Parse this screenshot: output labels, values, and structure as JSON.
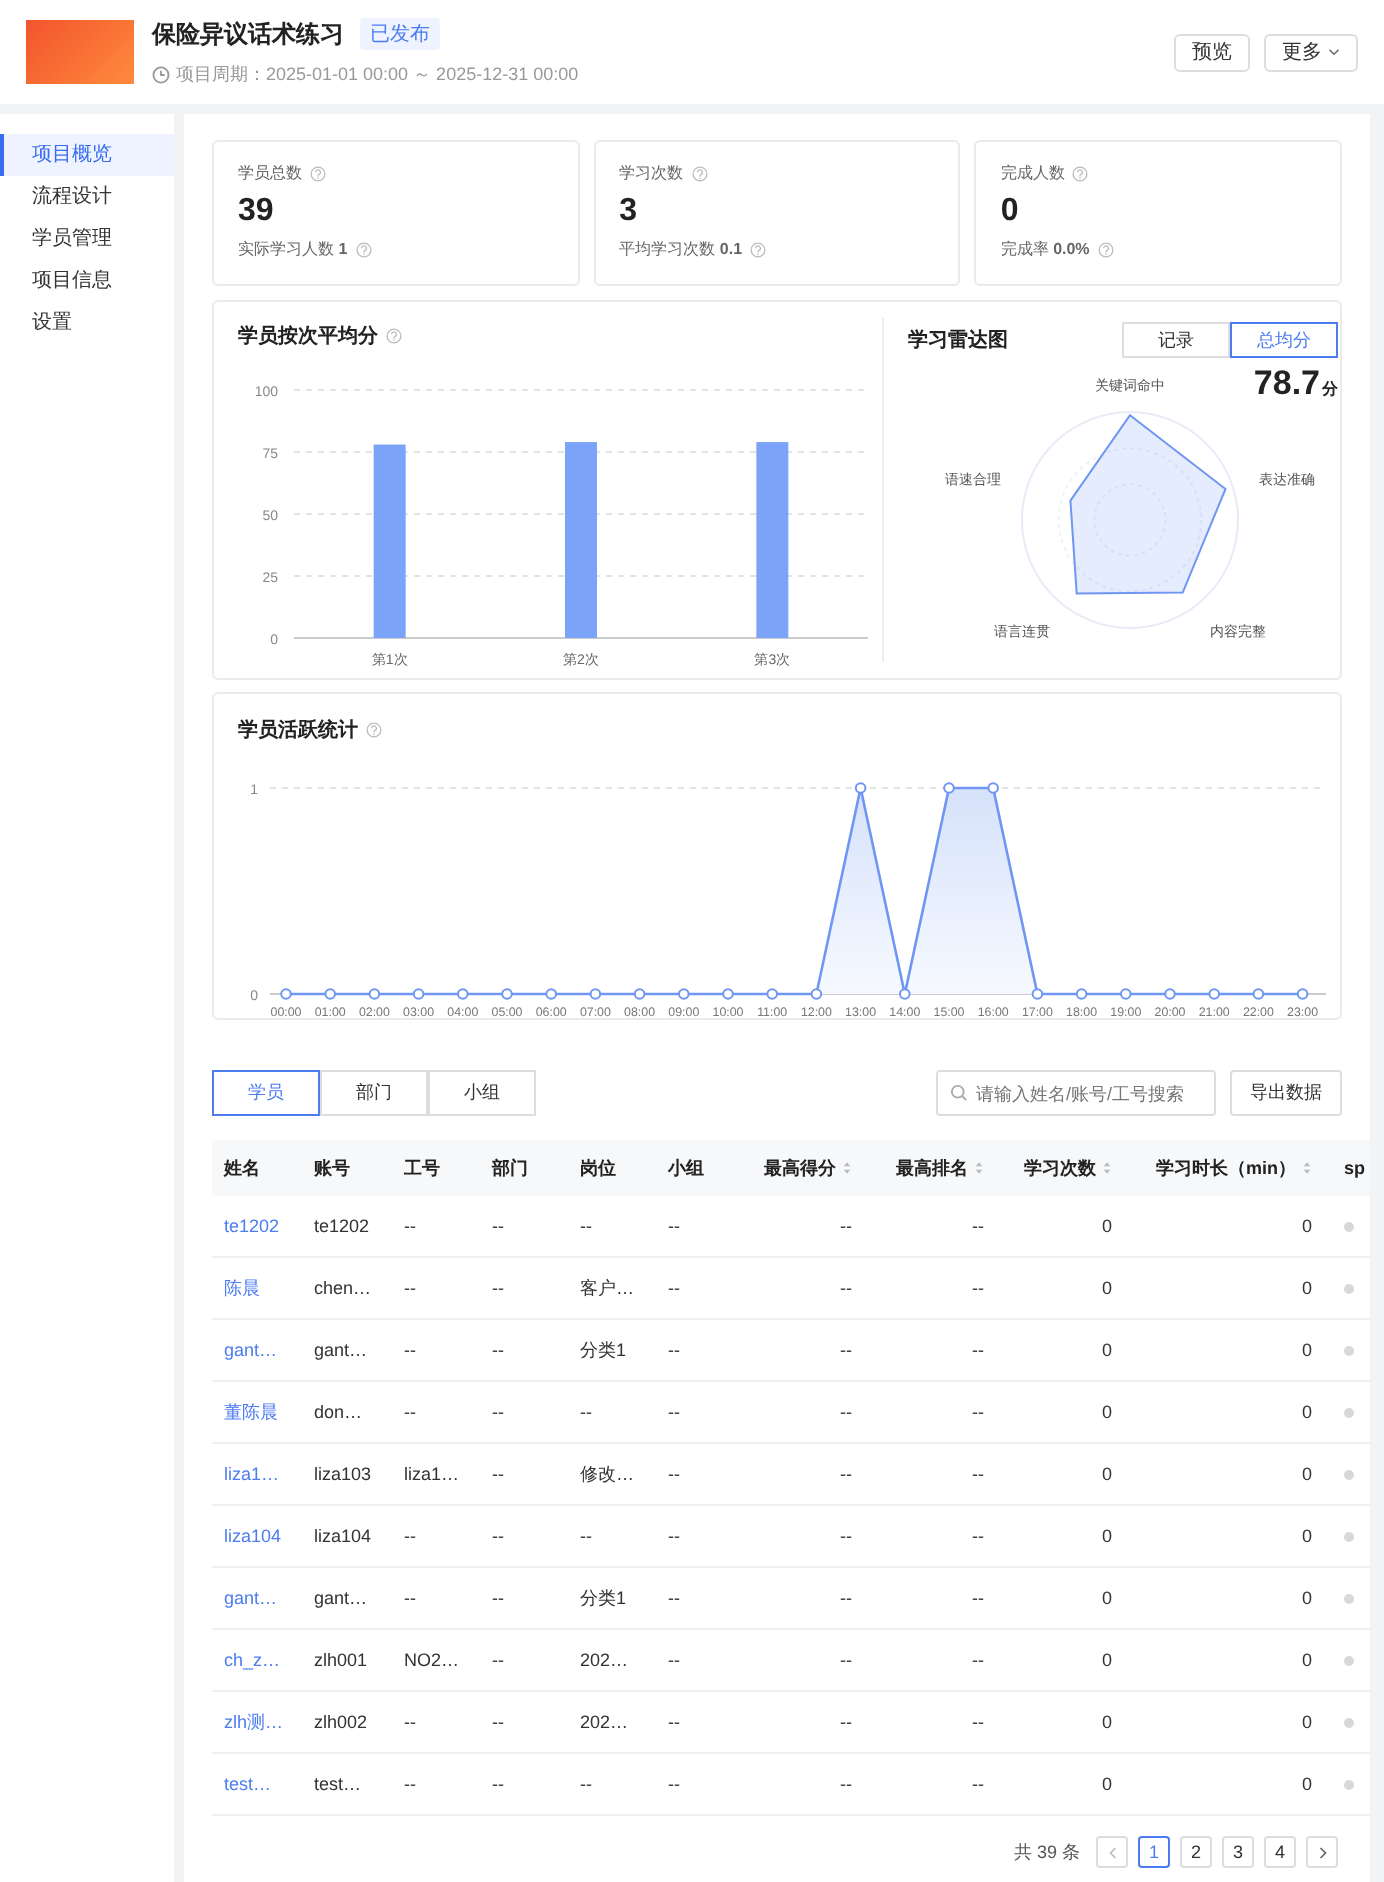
{
  "header": {
    "title": "保险异议话术练习",
    "status": "已发布",
    "period": "项目周期：2025-01-01 00:00 ～ 2025-12-31 00:00",
    "buttons": [
      {
        "label": "预览",
        "kind": "plain"
      },
      {
        "label": "更多",
        "kind": "dropdown"
      }
    ]
  },
  "sidebar": {
    "items": [
      {
        "label": "项目概览",
        "selected": true
      },
      {
        "label": "流程设计",
        "selected": false
      },
      {
        "label": "学员管理",
        "selected": false
      },
      {
        "label": "项目信息",
        "selected": false
      },
      {
        "label": "设置",
        "selected": false
      }
    ]
  },
  "stats": [
    {
      "label": "学员总数",
      "value": "39",
      "sub": "实际学习人数 **1**"
    },
    {
      "label": "学习次数",
      "value": "3",
      "sub": "平均学习次数 **0.1**"
    },
    {
      "label": "完成人数",
      "value": "0",
      "sub": "完成率 **0.0%**"
    }
  ],
  "score_chart": {
    "title": "学员按次平均分",
    "chart_data": {
      "type": "bar",
      "categories": [
        "第1次",
        "第2次",
        "第3次"
      ],
      "values": [
        78,
        79,
        79
      ],
      "grid": true,
      "ylim": [
        0,
        100
      ],
      "yticks": [
        0,
        25,
        50,
        75,
        100
      ]
    }
  },
  "radar": {
    "title": "学习雷达图",
    "toggle": [
      {
        "label": "记录",
        "selected": false
      },
      {
        "label": "总均分",
        "selected": true
      }
    ],
    "score": "78.7",
    "unit": "分",
    "axes": [
      "关键词命中",
      "表达准确",
      "内容完整",
      "语言连贯",
      "语速合理"
    ]
  },
  "activity_chart": {
    "title": "学员活跃统计",
    "chart_data": {
      "type": "area",
      "x": [
        "00:00",
        "01:00",
        "02:00",
        "03:00",
        "04:00",
        "05:00",
        "06:00",
        "07:00",
        "08:00",
        "09:00",
        "10:00",
        "11:00",
        "12:00",
        "13:00",
        "14:00",
        "15:00",
        "16:00",
        "17:00",
        "18:00",
        "19:00",
        "20:00",
        "21:00",
        "22:00",
        "23:00"
      ],
      "values": [
        0,
        0,
        0,
        0,
        0,
        0,
        0,
        0,
        0,
        0,
        0,
        0,
        0,
        1,
        0,
        1,
        1,
        0,
        0,
        0,
        0,
        0,
        0,
        0
      ],
      "ylim": [
        0,
        1
      ],
      "yticks": [
        0,
        1
      ]
    }
  },
  "view_tabs": [
    {
      "label": "学员",
      "selected": true
    },
    {
      "label": "部门",
      "selected": false
    },
    {
      "label": "小组",
      "selected": false
    }
  ],
  "search": {
    "placeholder": "请输入姓名/账号/工号搜索"
  },
  "export_button": "导出数据",
  "table": {
    "columns": [
      {
        "label": "姓名",
        "sortable": false
      },
      {
        "label": "账号",
        "sortable": false
      },
      {
        "label": "工号",
        "sortable": false
      },
      {
        "label": "部门",
        "sortable": false
      },
      {
        "label": "岗位",
        "sortable": false
      },
      {
        "label": "小组",
        "sortable": false
      },
      {
        "label": "最高得分",
        "sortable": true
      },
      {
        "label": "最高排名",
        "sortable": true
      },
      {
        "label": "学习次数",
        "sortable": true
      },
      {
        "label": "学习时长（min）",
        "sortable": true
      },
      {
        "label": "sp",
        "sortable": false
      }
    ],
    "rows": [
      [
        "te1202",
        "te1202",
        "--",
        "--",
        "--",
        "--",
        "--",
        "--",
        "0",
        "0"
      ],
      [
        "陈晨",
        "chen…",
        "--",
        "--",
        "客户…",
        "--",
        "--",
        "--",
        "0",
        "0"
      ],
      [
        "gant…",
        "gant…",
        "--",
        "--",
        "分类1",
        "--",
        "--",
        "--",
        "0",
        "0"
      ],
      [
        "董陈晨",
        "don…",
        "--",
        "--",
        "--",
        "--",
        "--",
        "--",
        "0",
        "0"
      ],
      [
        "liza1…",
        "liza103",
        "liza1…",
        "--",
        "修改…",
        "--",
        "--",
        "--",
        "0",
        "0"
      ],
      [
        "liza104",
        "liza104",
        "--",
        "--",
        "--",
        "--",
        "--",
        "--",
        "0",
        "0"
      ],
      [
        "gant…",
        "gant…",
        "--",
        "--",
        "分类1",
        "--",
        "--",
        "--",
        "0",
        "0"
      ],
      [
        "ch_z…",
        "zlh001",
        "NO2…",
        "--",
        "202…",
        "--",
        "--",
        "--",
        "0",
        "0"
      ],
      [
        "zlh测…",
        "zlh002",
        "--",
        "--",
        "202…",
        "--",
        "--",
        "--",
        "0",
        "0"
      ],
      [
        "test…",
        "test…",
        "--",
        "--",
        "--",
        "--",
        "--",
        "--",
        "0",
        "0"
      ]
    ]
  },
  "pagination": {
    "total": "共 39 条",
    "pages": [
      {
        "label": "1",
        "selected": true
      },
      {
        "label": "2",
        "selected": false
      },
      {
        "label": "3",
        "selected": false
      },
      {
        "label": "4",
        "selected": false
      }
    ]
  }
}
